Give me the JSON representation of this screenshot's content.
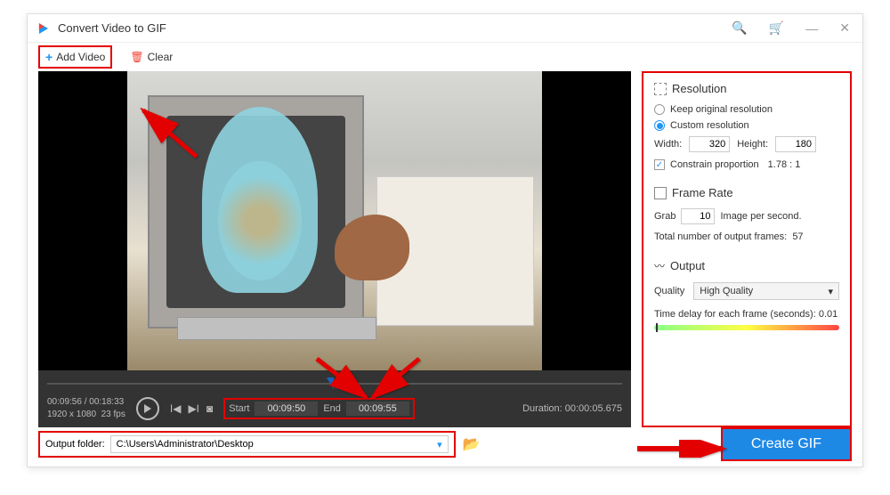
{
  "window": {
    "title": "Convert Video to GIF"
  },
  "toolbar": {
    "add_video": "Add Video",
    "clear": "Clear"
  },
  "video": {
    "time_elapsed": "00:09:56",
    "time_total": "00:18:33",
    "resolution": "1920 x 1080",
    "fps": "23 fps",
    "start_label": "Start",
    "start_time": "00:09:50",
    "end_label": "End",
    "end_time": "00:09:55",
    "duration_label": "Duration:",
    "duration_value": "00:00:05.675"
  },
  "panel": {
    "resolution": {
      "title": "Resolution",
      "keep": "Keep original resolution",
      "custom": "Custom resolution",
      "width_label": "Width:",
      "width": "320",
      "height_label": "Height:",
      "height": "180",
      "constrain": "Constrain proportion",
      "ratio": "1.78 : 1"
    },
    "framerate": {
      "title": "Frame Rate",
      "grab_label": "Grab",
      "grab_value": "10",
      "grab_suffix": "Image per second.",
      "total_label": "Total number of output frames:",
      "total_value": "57"
    },
    "output": {
      "title": "Output",
      "quality_label": "Quality",
      "quality_value": "High Quality",
      "delay_label": "Time delay for each frame (seconds):",
      "delay_value": "0.01"
    }
  },
  "footer": {
    "output_label": "Output folder:",
    "output_path": "C:\\Users\\Administrator\\Desktop",
    "create_button": "Create GIF"
  }
}
